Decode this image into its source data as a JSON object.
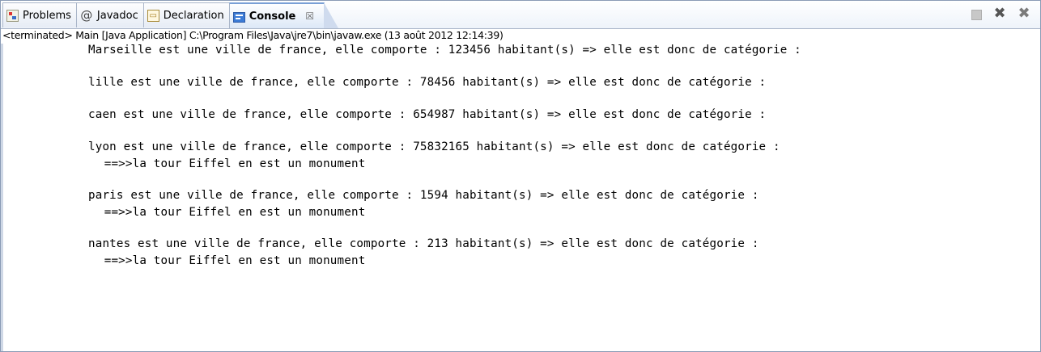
{
  "tabs": [
    {
      "label": "Problems",
      "icon": "problems-icon"
    },
    {
      "label": "Javadoc",
      "icon": "javadoc-icon"
    },
    {
      "label": "Declaration",
      "icon": "declaration-icon"
    },
    {
      "label": "Console",
      "icon": "console-icon",
      "active": true,
      "close": "☒"
    }
  ],
  "toolbar": {
    "terminate": "stop-icon",
    "remove": "remove-launch-icon",
    "remove_all": "remove-all-terminated-icon"
  },
  "status_line": "<terminated> Main [Java Application] C:\\Program Files\\Java\\jre7\\bin\\javaw.exe (13 août 2012 12:14:39)",
  "output": [
    "Marseille est une ville de france, elle comporte : 123456 habitant(s) => elle est donc de catégorie :",
    "lille est une ville de france, elle comporte : 78456 habitant(s) => elle est donc de catégorie :",
    "caen est une ville de france, elle comporte : 654987 habitant(s) => elle est donc de catégorie :",
    "lyon est une ville de france, elle comporte : 75832165 habitant(s) => elle est donc de catégorie :",
    " ==>>la tour Eiffel en est un monument",
    "paris est une ville de france, elle comporte : 1594 habitant(s) => elle est donc de catégorie :",
    " ==>>la tour Eiffel en est un monument",
    "nantes est une ville de france, elle comporte : 213 habitant(s) => elle est donc de catégorie :",
    " ==>>la tour Eiffel en est un monument"
  ]
}
